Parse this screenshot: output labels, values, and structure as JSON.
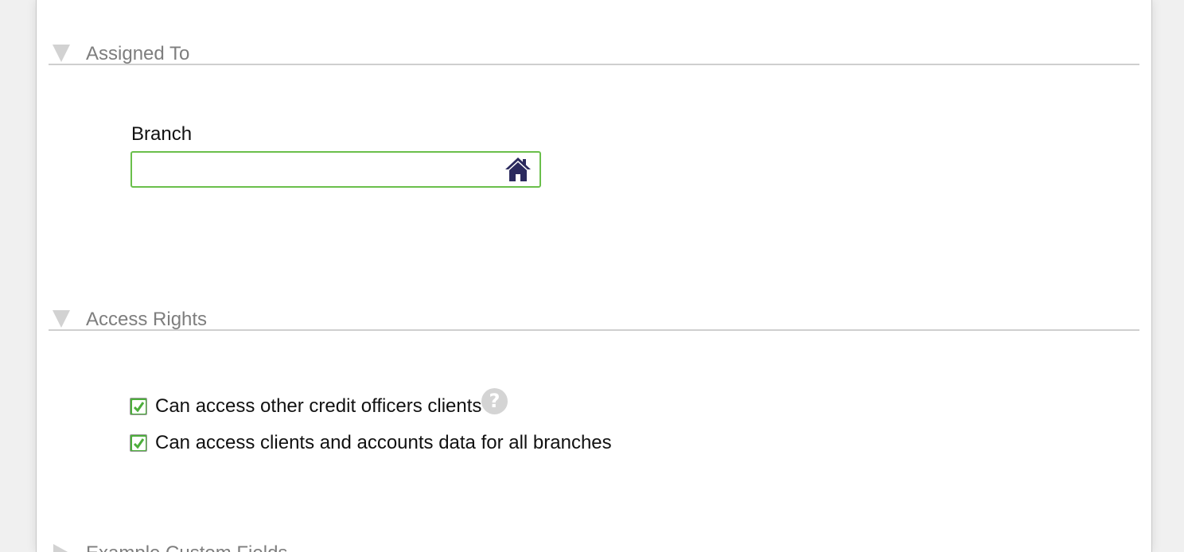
{
  "sections": {
    "assigned_to": {
      "title": "Assigned To",
      "branch_label": "Branch",
      "branch_value": "",
      "branch_icon": "home-icon"
    },
    "access_rights": {
      "title": "Access Rights",
      "options": [
        {
          "label": "Can access other credit officers clients",
          "checked": true,
          "help_icon": "?"
        },
        {
          "label": "Can access clients and accounts data for all branches",
          "checked": true
        }
      ]
    },
    "custom_fields": {
      "title": "Example Custom Fields"
    }
  },
  "colors": {
    "section_title": "#7e7e7e",
    "input_border": "#6abf4b",
    "checkbox_fill": "#4cae3b",
    "home_icon": "#2b2a5e"
  }
}
